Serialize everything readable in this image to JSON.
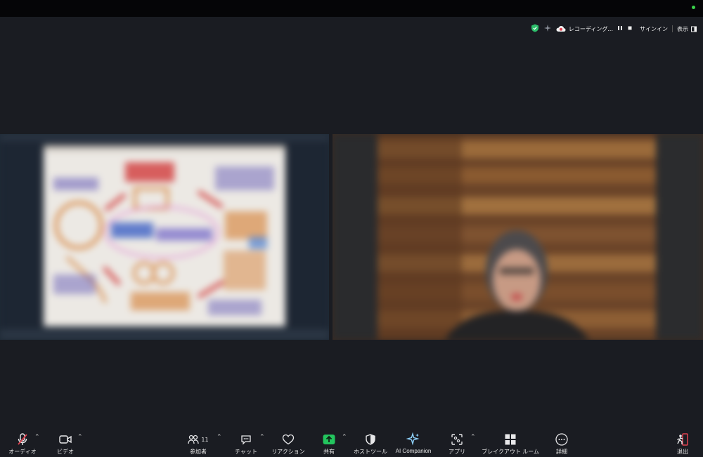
{
  "meeting": {
    "recording_label": "レコーディング...",
    "signin_label": "サインイン",
    "view_label": "表示"
  },
  "toolbar": {
    "audio": "オーディオ",
    "video": "ビデオ",
    "participants": "参加者",
    "participants_count": "11",
    "chat": "チャット",
    "reactions": "リアクション",
    "share": "共有",
    "host_tools": "ホストツール",
    "ai_companion": "AI Companion",
    "apps": "アプリ",
    "breakout": "ブレイクアウト ルーム",
    "more": "詳細",
    "leave": "退出"
  },
  "colors": {
    "share_green": "#23c55e",
    "mute_red": "#e0414f",
    "background": "#1a1c22",
    "ai_accent": "#8fd3ff"
  },
  "icons": [
    "shield-icon",
    "sparkle-icon",
    "cloud-record-icon",
    "pause-icon",
    "stop-icon",
    "view-icon",
    "mic-muted-icon",
    "video-icon",
    "participants-icon",
    "chat-icon",
    "heart-icon",
    "share-arrow-icon",
    "host-shield-icon",
    "ai-sparkle-icon",
    "apps-icon",
    "grid-icon",
    "more-icon",
    "leave-icon"
  ]
}
